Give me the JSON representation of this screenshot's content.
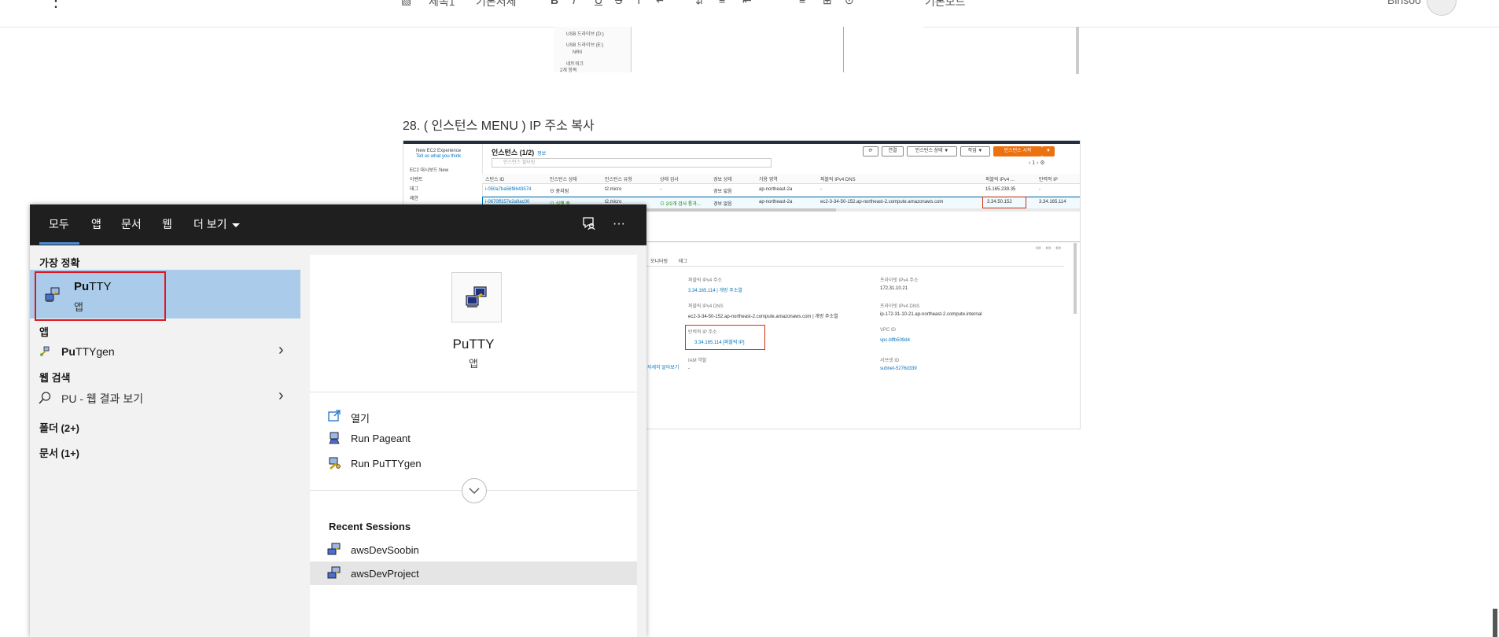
{
  "editor": {
    "toolbar_fragments": [
      "제목1",
      "기본서체",
      "B",
      "I",
      "U",
      "S",
      "T",
      "↵",
      "⇵",
      "≡",
      "⇤",
      "≡",
      "⊞",
      "⊙",
      "기본모드"
    ],
    "user_name": "Binsoo"
  },
  "prev_screenshot": {
    "lines": [
      "USB 드라이브 (D:)",
      "USB 드라이브 (E:)",
      "NRII",
      "네트워크",
      "2개 항목"
    ]
  },
  "step_heading": "28. ( 인스턴스 MENU ) IP 주소 복사",
  "aws": {
    "nav": [
      "New EC2 Experience",
      "Tell us what you think",
      "EC2 대시보드 New",
      "이벤트",
      "태그",
      "제한"
    ],
    "title": "인스턴스 (1/2)",
    "title_info": "정보",
    "search_placeholder": "인스턴스 필터링",
    "buttons": [
      "⟳",
      "연결",
      "인스턴스 상태 ▼",
      "작업 ▼",
      "인스턴스 시작",
      "▼"
    ],
    "pager": "‹ 1 › ⚙",
    "headers": [
      "스턴스 ID",
      "인스턴스 상태",
      "인스턴스 유형",
      "상태 검사",
      "경보 상태",
      "가용 영역",
      "퍼블릭 IPv4 DNS",
      "퍼블릭 IPv4 ...",
      "탄력적 IP"
    ],
    "rows": [
      {
        "id": "i-050a7ba56f8643574",
        "state": "⊖ 중지됨",
        "type": "t2.micro",
        "check": "-",
        "alarm": "경보 없음",
        "az": "ap-northeast-2a",
        "dns": "-",
        "ipv4": "15.165.239.35",
        "eip": "-"
      },
      {
        "id": "i-0670ff157e2a0ac00",
        "state": "⊙ 실행 중",
        "type": "t2.micro",
        "check": "⊙ 2/2개 검사 통과...",
        "alarm": "경보 없음",
        "az": "ap-northeast-2a",
        "dns": "ec2-3-34-50-152.ap-northeast-2.compute.amazonaws.com",
        "ipv4": "3.34.50.152",
        "eip": "3.34.165.114"
      }
    ],
    "detail_tabs": [
      "모니터링",
      "태그"
    ],
    "details": {
      "pub_ipv4_label": "퍼블릭 IPv4 주소",
      "pub_ipv4_value": "3.34.165.114 | 개방 주소열",
      "priv_ipv4_label": "프라이빗 IPv4 주소",
      "priv_ipv4_value": "172.31.10.21",
      "pub_dns_label": "퍼블릭 IPv4 DNS",
      "pub_dns_value": "ec2-3-34-50-152.ap-northeast-2.compute.amazonaws.com | 개방 주소열",
      "priv_dns_label": "프라이빗 IPv4 DNS",
      "priv_dns_value": "ip-172-31-10-21.ap-northeast-2.compute.internal",
      "eip_label": "탄력적 IP 주소",
      "eip_value": "3.34.165.114 [퍼블릭 IP]",
      "vpc_label": "VPC ID",
      "vpc_value": "vpc-bffb509d4",
      "iam_label": "IAM 역할",
      "iam_value": "-",
      "subnet_label": "서브넷 ID",
      "subnet_value": "subnet-5276d339",
      "left_frag": "자세히 알아보기"
    }
  },
  "start_search": {
    "tabs": [
      "모두",
      "앱",
      "문서",
      "웹",
      "더 보기"
    ],
    "header_icons": [
      "feedback-icon",
      "more-icon"
    ],
    "more_glyph": "···",
    "best_match_label": "가장 정확",
    "best_match": {
      "name_bold": "Pu",
      "name_rest": "TTY",
      "type": "앱"
    },
    "apps_label": "앱",
    "apps": [
      {
        "name_bold": "Pu",
        "name_rest": "TTYgen"
      }
    ],
    "web_label": "웹 검색",
    "web_query": "PU",
    "web_suffix": " - 웹 결과 보기",
    "folders_label": "폴더 (2+)",
    "docs_label": "문서 (1+)",
    "detail": {
      "app_name": "PuTTY",
      "app_type": "앱",
      "actions": [
        "열기",
        "Run Pageant",
        "Run PuTTYgen"
      ],
      "recent_label": "Recent Sessions",
      "sessions": [
        "awsDevSoobin",
        "awsDevProject"
      ]
    }
  },
  "colors": {
    "header_bg": "#1f1f1f",
    "selection_bg": "#aacbe9",
    "highlight_red": "#e0151d",
    "tab_underline": "#4c8fd6"
  }
}
